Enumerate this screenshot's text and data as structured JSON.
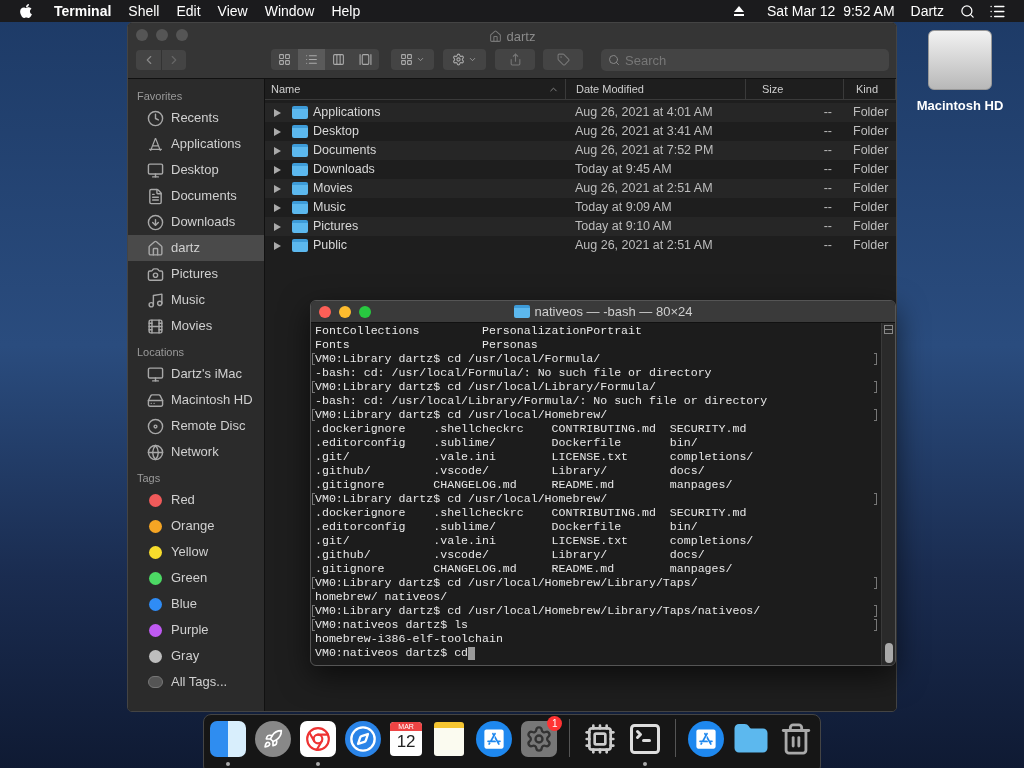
{
  "menu_bar": {
    "app_name": "Terminal",
    "menus": [
      "Shell",
      "Edit",
      "View",
      "Window",
      "Help"
    ],
    "clock": "Sat Mar 12  9:52 AM",
    "user": "Dartz"
  },
  "desktop_icons": [
    {
      "label": "Macintosh HD"
    }
  ],
  "finder": {
    "title": "dartz",
    "views": [
      {
        "selected": false
      },
      {
        "selected": true
      },
      {
        "selected": false
      },
      {
        "selected": false
      }
    ],
    "search": {
      "placeholder": "Search"
    },
    "sidebar": [
      {
        "heading": "Favorites",
        "items": [
          {
            "label": "Recents",
            "selected": false
          },
          {
            "label": "Applications",
            "selected": false
          },
          {
            "label": "Desktop",
            "selected": false
          },
          {
            "label": "Documents",
            "selected": false
          },
          {
            "label": "Downloads",
            "selected": false
          },
          {
            "label": "dartz",
            "selected": true
          },
          {
            "label": "Pictures",
            "selected": false
          },
          {
            "label": "Music",
            "selected": false
          },
          {
            "label": "Movies",
            "selected": false
          }
        ]
      },
      {
        "heading": "Locations",
        "items": [
          {
            "label": "Dartz's iMac",
            "selected": false
          },
          {
            "label": "Macintosh HD",
            "selected": false
          },
          {
            "label": "Remote Disc",
            "selected": false
          },
          {
            "label": "Network",
            "selected": false
          }
        ]
      },
      {
        "heading": "Tags",
        "items": [
          {
            "label": "Red",
            "selected": false,
            "color": "#f05a5a"
          },
          {
            "label": "Orange",
            "selected": false,
            "color": "#f5a524"
          },
          {
            "label": "Yellow",
            "selected": false,
            "color": "#f7dc2c"
          },
          {
            "label": "Green",
            "selected": false,
            "color": "#4cd964"
          },
          {
            "label": "Blue",
            "selected": false,
            "color": "#2f8cf5"
          },
          {
            "label": "Purple",
            "selected": false,
            "color": "#bf5af2"
          },
          {
            "label": "Gray",
            "selected": false,
            "color": "#bdbdbd"
          },
          {
            "label": "All Tags...",
            "selected": false
          }
        ]
      }
    ],
    "columns": [
      "Name",
      "Date Modified",
      "Size",
      "Kind"
    ],
    "rows": [
      {
        "name": "Applications",
        "date": "Aug 26, 2021 at 4:01 AM",
        "size": "--",
        "kind": "Folder"
      },
      {
        "name": "Desktop",
        "date": "Aug 26, 2021 at 3:41 AM",
        "size": "--",
        "kind": "Folder"
      },
      {
        "name": "Documents",
        "date": "Aug 26, 2021 at 7:52 PM",
        "size": "--",
        "kind": "Folder"
      },
      {
        "name": "Downloads",
        "date": "Today at 9:45 AM",
        "size": "--",
        "kind": "Folder"
      },
      {
        "name": "Movies",
        "date": "Aug 26, 2021 at 2:51 AM",
        "size": "--",
        "kind": "Folder"
      },
      {
        "name": "Music",
        "date": "Today at 9:09 AM",
        "size": "--",
        "kind": "Folder"
      },
      {
        "name": "Pictures",
        "date": "Today at 9:10 AM",
        "size": "--",
        "kind": "Folder"
      },
      {
        "name": "Public",
        "date": "Aug 26, 2021 at 2:51 AM",
        "size": "--",
        "kind": "Folder"
      }
    ]
  },
  "terminal": {
    "title": "nativeos — -bash — 80×24",
    "lines": [
      {
        "kind": "output",
        "text": "FontCollections         PersonalizationPortrait"
      },
      {
        "kind": "output",
        "text": "Fonts                   Personas"
      },
      {
        "kind": "prompt",
        "text": "VM0:Library dartz$ cd /usr/local/Formula/"
      },
      {
        "kind": "output",
        "text": "-bash: cd: /usr/local/Formula/: No such file or directory"
      },
      {
        "kind": "prompt",
        "text": "VM0:Library dartz$ cd /usr/local/Library/Formula/"
      },
      {
        "kind": "output",
        "text": "-bash: cd: /usr/local/Library/Formula/: No such file or directory"
      },
      {
        "kind": "prompt",
        "text": "VM0:Library dartz$ cd /usr/local/Homebrew/"
      },
      {
        "kind": "output",
        "text": ".dockerignore    .shellcheckrc    CONTRIBUTING.md  SECURITY.md"
      },
      {
        "kind": "output",
        "text": ".editorconfig    .sublime/        Dockerfile       bin/"
      },
      {
        "kind": "output",
        "text": ".git/            .vale.ini        LICENSE.txt      completions/"
      },
      {
        "kind": "output",
        "text": ".github/         .vscode/         Library/         docs/"
      },
      {
        "kind": "output",
        "text": ".gitignore       CHANGELOG.md     README.md        manpages/"
      },
      {
        "kind": "prompt",
        "text": "VM0:Library dartz$ cd /usr/local/Homebrew/"
      },
      {
        "kind": "output",
        "text": ".dockerignore    .shellcheckrc    CONTRIBUTING.md  SECURITY.md"
      },
      {
        "kind": "output",
        "text": ".editorconfig    .sublime/        Dockerfile       bin/"
      },
      {
        "kind": "output",
        "text": ".git/            .vale.ini        LICENSE.txt      completions/"
      },
      {
        "kind": "output",
        "text": ".github/         .vscode/         Library/         docs/"
      },
      {
        "kind": "output",
        "text": ".gitignore       CHANGELOG.md     README.md        manpages/"
      },
      {
        "kind": "prompt",
        "text": "VM0:Library dartz$ cd /usr/local/Homebrew/Library/Taps/"
      },
      {
        "kind": "output",
        "text": "homebrew/ nativeos/"
      },
      {
        "kind": "prompt",
        "text": "VM0:Library dartz$ cd /usr/local/Homebrew/Library/Taps/nativeos/"
      },
      {
        "kind": "prompt",
        "text": "VM0:nativeos dartz$ ls"
      },
      {
        "kind": "output",
        "text": "homebrew-i386-elf-toolchain"
      },
      {
        "kind": "input",
        "text": "VM0:nativeos dartz$ cd"
      }
    ]
  },
  "dock": [
    {
      "kind": "app",
      "running": true
    },
    {
      "kind": "app",
      "running": false
    },
    {
      "kind": "app",
      "running": true
    },
    {
      "kind": "app",
      "running": false
    },
    {
      "kind": "calendar",
      "running": false,
      "month": "MAR",
      "day": "12"
    },
    {
      "kind": "app",
      "running": false
    },
    {
      "kind": "app",
      "running": false
    },
    {
      "kind": "app",
      "running": false,
      "badge": "1"
    },
    {
      "kind": "separator"
    },
    {
      "kind": "app",
      "running": false
    },
    {
      "kind": "app",
      "running": true
    },
    {
      "kind": "separator"
    },
    {
      "kind": "app",
      "running": false
    },
    {
      "kind": "app",
      "running": false
    },
    {
      "kind": "app",
      "running": false
    }
  ]
}
